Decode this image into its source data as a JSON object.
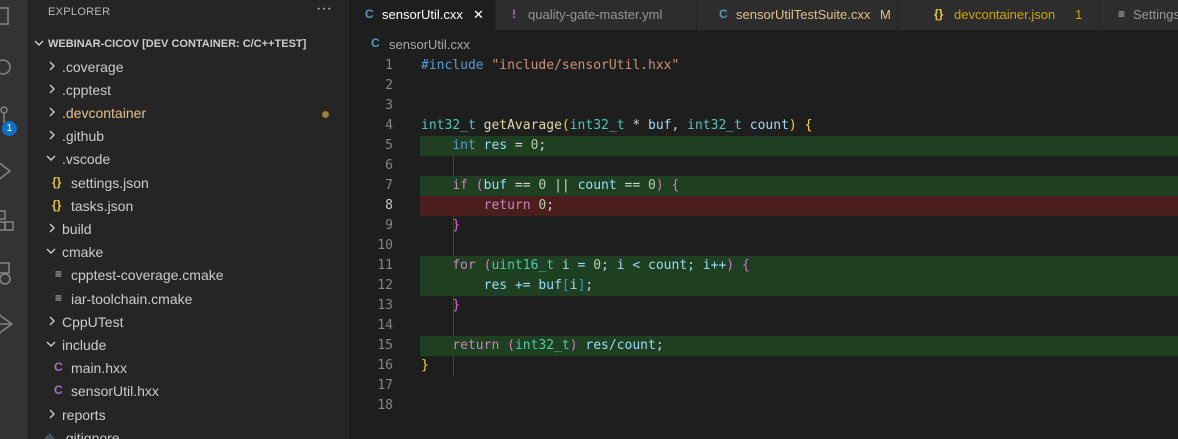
{
  "sidebar": {
    "title": "EXPLORER",
    "more": "···",
    "root_label": "WEBINAR-CICOV [DEV CONTAINER: C/C++TEST]",
    "items": [
      {
        "label": ".coverage",
        "kind": "folder"
      },
      {
        "label": ".cpptest",
        "kind": "folder"
      },
      {
        "label": ".devcontainer",
        "kind": "folder",
        "modified": true
      },
      {
        "label": ".github",
        "kind": "folder"
      },
      {
        "label": ".vscode",
        "kind": "folder",
        "expanded": true
      },
      {
        "label": "settings.json",
        "kind": "json-file",
        "icon": "{}"
      },
      {
        "label": "tasks.json",
        "kind": "json-file",
        "icon": "{}"
      },
      {
        "label": "build",
        "kind": "folder"
      },
      {
        "label": "cmake",
        "kind": "folder",
        "expanded": true
      },
      {
        "label": "cpptest-coverage.cmake",
        "kind": "cmake-file",
        "icon": "≡"
      },
      {
        "label": "iar-toolchain.cmake",
        "kind": "cmake-file",
        "icon": "≡"
      },
      {
        "label": "CppUTest",
        "kind": "folder"
      },
      {
        "label": "include",
        "kind": "folder",
        "expanded": true
      },
      {
        "label": "main.hxx",
        "kind": "cpp-file",
        "icon": "C"
      },
      {
        "label": "sensorUtil.hxx",
        "kind": "cpp-file",
        "icon": "C"
      },
      {
        "label": "reports",
        "kind": "folder"
      },
      {
        "label": ".gitignore",
        "kind": "file"
      }
    ]
  },
  "activity": {
    "scm_badge": "1"
  },
  "tabs": [
    {
      "icon": "C",
      "label": "sensorUtil.cxx",
      "close": "✕",
      "active": true
    },
    {
      "icon": "!",
      "label": "quality-gate-master.yml"
    },
    {
      "icon": "C",
      "label": "sensorUtilTestSuite.cxx",
      "mark": "M"
    },
    {
      "icon": "{}",
      "label": "devcontainer.json",
      "mark": "1"
    },
    {
      "icon": "≡",
      "label": "Settings"
    }
  ],
  "breadcrumb": {
    "icon": "C",
    "label": "sensorUtil.cxx"
  },
  "editor": {
    "current_line": 8,
    "line_numbers": [
      "1",
      "2",
      "3",
      "4",
      "5",
      "6",
      "7",
      "8",
      "9",
      "10",
      "11",
      "12",
      "13",
      "14",
      "15",
      "16",
      "17",
      "18"
    ],
    "code": {
      "l1_include": "#include",
      "l1_path": "\"include/sensorUtil.hxx\"",
      "l4_type": "int32_t",
      "l4_fn": "getAvarage",
      "l4_open": "(",
      "l4_type2": "int32_t",
      "l4_star": " * ",
      "l4_buf": "buf",
      "l4_comma": ", ",
      "l4_type3": "int32_t",
      "l4_count": "count",
      "l4_close": ")",
      "l4_brace": "{",
      "l5_type": "int",
      "l5_res": "res",
      "l5_eq": " = ",
      "l5_num": "0",
      "l5_semi": ";",
      "l7_if": "if",
      "l7_open": "(",
      "l7_buf": "buf",
      "l7_eq1": " == ",
      "l7_z1": "0",
      "l7_or": " || ",
      "l7_count": "count",
      "l7_eq2": " == ",
      "l7_z2": "0",
      "l7_close": ")",
      "l7_brace": "{",
      "l8_return": "return",
      "l8_num": "0",
      "l8_semi": ";",
      "l9_brace": "}",
      "l11_for": "for",
      "l11_open": "(",
      "l11_type": "uint16_t",
      "l11_rest1": " i = ",
      "l11_z": "0",
      "l11_rest2": "; i < count; i++",
      "l11_close": ")",
      "l11_brace": "{",
      "l12_res": "res += buf",
      "l12_ob": "[",
      "l12_i": "i",
      "l12_cb": "]",
      "l12_semi": ";",
      "l13_brace": "}",
      "l15_return": "return",
      "l15_open": "(",
      "l15_type": "int32_t",
      "l15_close": ")",
      "l15_rest": " res/count;",
      "l16_brace": "}"
    },
    "coverage": {
      "covered_lines": [
        5,
        7,
        11,
        12,
        15
      ],
      "uncovered_lines": [
        8
      ],
      "covered_color": "#1f3f21",
      "uncovered_color": "#4b1d1d"
    }
  },
  "colors": {
    "accent": "#0e70c0",
    "modified": "#e2c08d"
  }
}
